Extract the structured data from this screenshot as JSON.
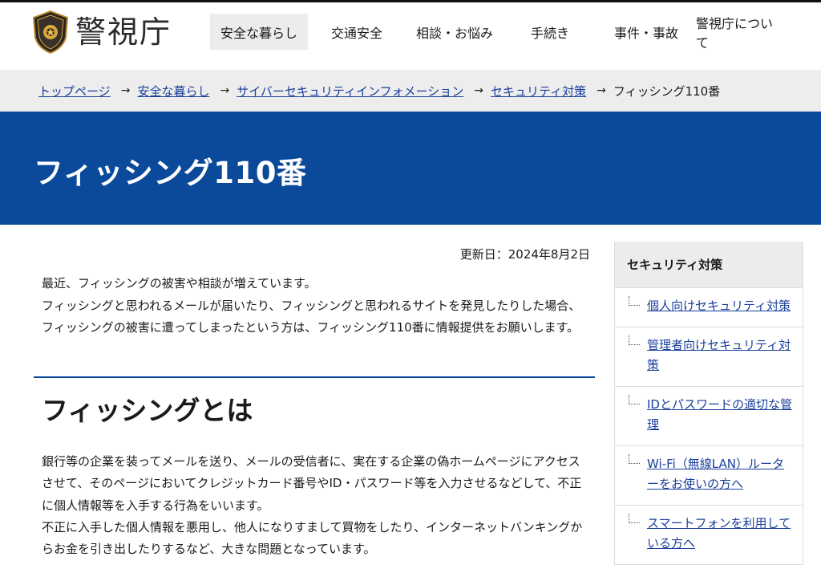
{
  "header": {
    "logo_text": "警視庁",
    "nav": [
      {
        "label": "安全な暮らし",
        "active": true
      },
      {
        "label": "交通安全",
        "active": false
      },
      {
        "label": "相談・お悩み",
        "active": false
      },
      {
        "label": "手続き",
        "active": false
      },
      {
        "label": "事件・事故",
        "active": false
      },
      {
        "label": "警視庁について",
        "active": false
      }
    ]
  },
  "breadcrumb": {
    "items": [
      "トップページ",
      "安全な暮らし",
      "サイバーセキュリティインフォメーション",
      "セキュリティ対策"
    ],
    "current": "フィッシング110番",
    "separator": "→"
  },
  "page": {
    "title": "フィッシング110番",
    "updated": "更新日：2024年8月2日",
    "lead": [
      "最近、フィッシングの被害や相談が増えています。",
      "フィッシングと思われるメールが届いたり、フィッシングと思われるサイトを発見したりした場合、フィッシングの被害に遭ってしまったという方は、フィッシング110番に情報提供をお願いします。"
    ],
    "section_heading": "フィッシングとは",
    "section_body": [
      "銀行等の企業を装ってメールを送り、メールの受信者に、実在する企業の偽ホームページにアクセスさせて、そのページにおいてクレジットカード番号やID・パスワード等を入力させるなどして、不正に個人情報等を入手する行為をいいます。",
      "不正に入手した個人情報を悪用し、他人になりすまして買物をしたり、インターネットバンキングからお金を引き出したりするなど、大きな問題となっています。"
    ]
  },
  "sidebar": {
    "heading": "セキュリティ対策",
    "items": [
      "個人向けセキュリティ対策",
      "管理者向けセキュリティ対策",
      "IDとパスワードの適切な管理",
      "Wi-Fi（無線LAN）ルーターをお使いの方へ",
      "スマートフォンを利用している方へ"
    ]
  },
  "colors": {
    "brand_blue": "#0b4a9b",
    "link": "#1a3f9c",
    "breadcrumb_bg": "#ededed"
  }
}
